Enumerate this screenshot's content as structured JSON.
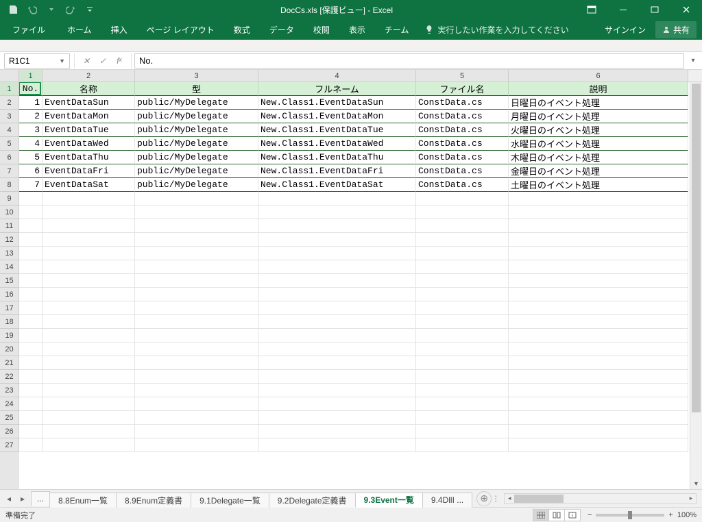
{
  "app_title": "DocCs.xls [保護ビュー] - Excel",
  "qat": {
    "save": "保存",
    "undo": "元に戻す",
    "redo": "やり直し"
  },
  "win": {
    "signin": "サインイン",
    "share": "共有"
  },
  "ribbon": {
    "file": "ファイル",
    "tabs": [
      "ホーム",
      "挿入",
      "ページ レイアウト",
      "数式",
      "データ",
      "校閲",
      "表示",
      "チーム"
    ],
    "tell_placeholder": "実行したい作業を入力してください"
  },
  "namebox": "R1C1",
  "formula": "No.",
  "columns": [
    "1",
    "2",
    "3",
    "4",
    "5",
    "6"
  ],
  "headers": [
    "No.",
    "名称",
    "型",
    "フルネーム",
    "ファイル名",
    "説明"
  ],
  "rows": [
    {
      "no": "1",
      "name": "EventDataSun",
      "type": "public/MyDelegate",
      "full": "New.Class1.EventDataSun",
      "file": "ConstData.cs",
      "desc": "日曜日のイベント処理"
    },
    {
      "no": "2",
      "name": "EventDataMon",
      "type": "public/MyDelegate",
      "full": "New.Class1.EventDataMon",
      "file": "ConstData.cs",
      "desc": "月曜日のイベント処理"
    },
    {
      "no": "3",
      "name": "EventDataTue",
      "type": "public/MyDelegate",
      "full": "New.Class1.EventDataTue",
      "file": "ConstData.cs",
      "desc": "火曜日のイベント処理"
    },
    {
      "no": "4",
      "name": "EventDataWed",
      "type": "public/MyDelegate",
      "full": "New.Class1.EventDataWed",
      "file": "ConstData.cs",
      "desc": "水曜日のイベント処理"
    },
    {
      "no": "5",
      "name": "EventDataThu",
      "type": "public/MyDelegate",
      "full": "New.Class1.EventDataThu",
      "file": "ConstData.cs",
      "desc": "木曜日のイベント処理"
    },
    {
      "no": "6",
      "name": "EventDataFri",
      "type": "public/MyDelegate",
      "full": "New.Class1.EventDataFri",
      "file": "ConstData.cs",
      "desc": "金曜日のイベント処理"
    },
    {
      "no": "7",
      "name": "EventDataSat",
      "type": "public/MyDelegate",
      "full": "New.Class1.EventDataSat",
      "file": "ConstData.cs",
      "desc": "土曜日のイベント処理"
    }
  ],
  "empty_rows": 19,
  "sheet_tabs": {
    "ellipsis": "...",
    "list": [
      "8.8Enum一覧",
      "8.9Enum定義書",
      "9.1Delegate一覧",
      "9.2Delegate定義書",
      "9.3Event一覧",
      "9.4DllI ..."
    ],
    "active_index": 4
  },
  "status": {
    "ready": "準備完了",
    "zoom": "100%",
    "minus": "−",
    "plus": "+"
  }
}
